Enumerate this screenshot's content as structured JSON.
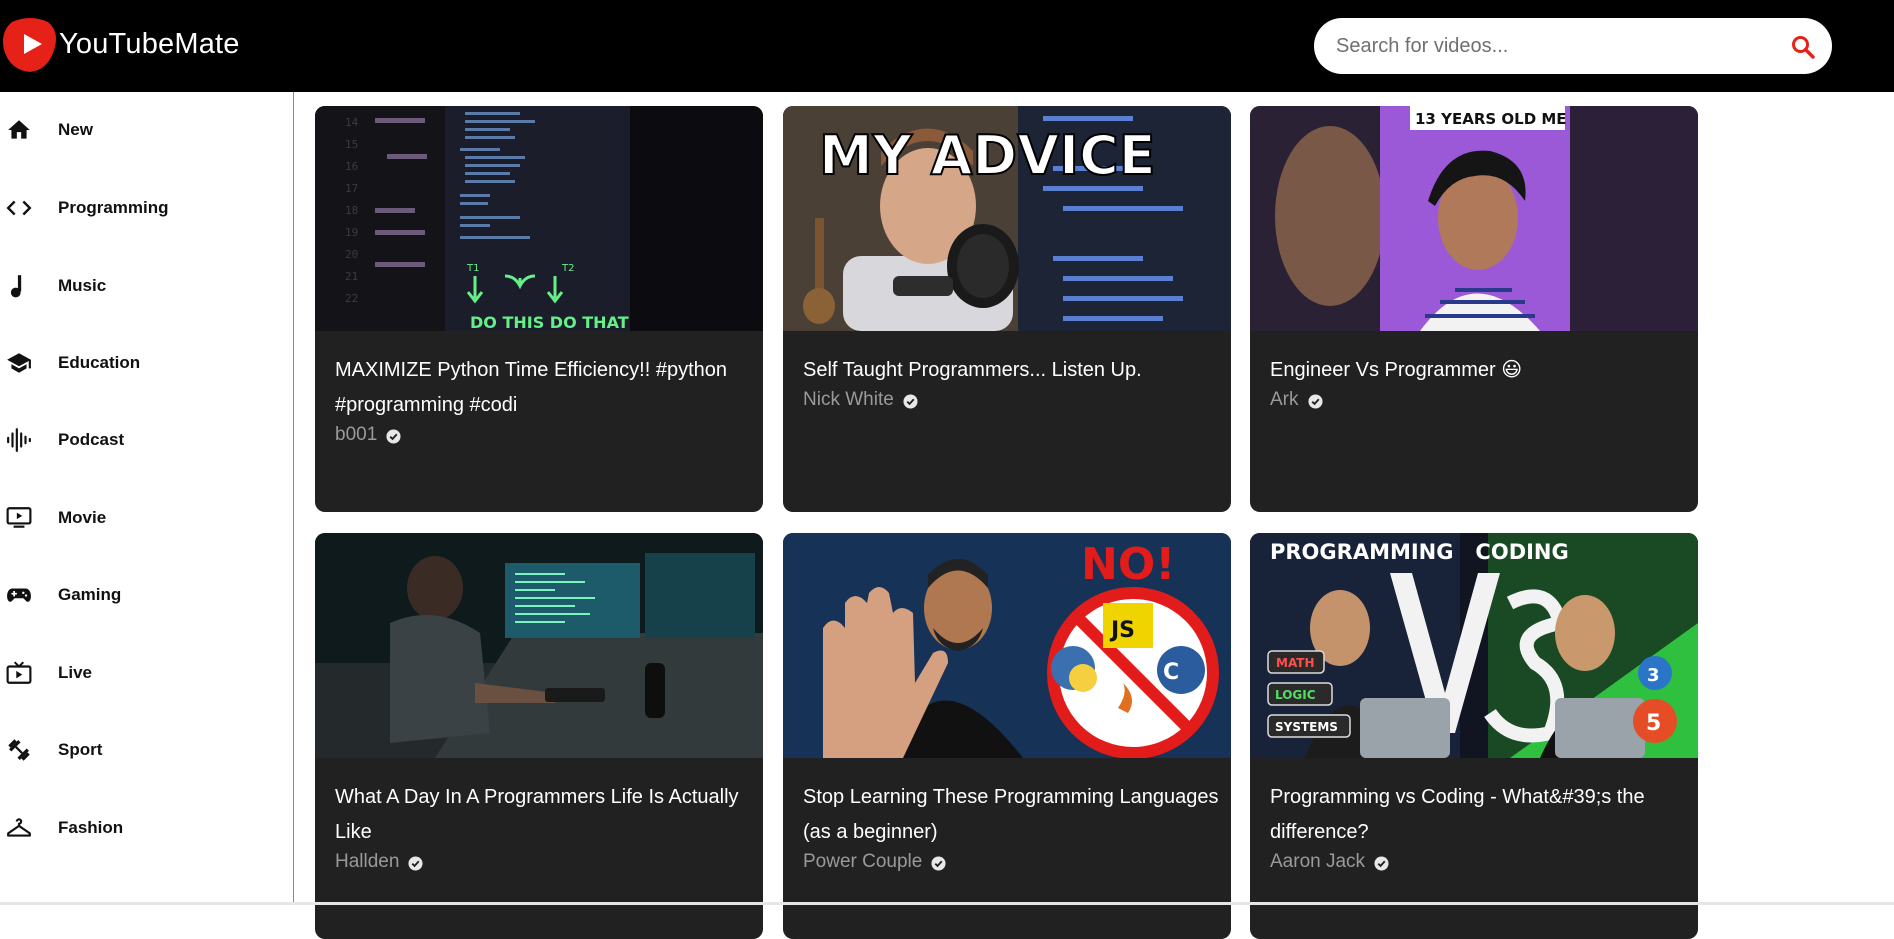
{
  "app": {
    "name": "YouTubeMate",
    "brand_color": "#e62117"
  },
  "search": {
    "placeholder": "Search for videos...",
    "icon": "search-icon"
  },
  "sidebar": {
    "items": [
      {
        "label": "New",
        "icon": "home-icon"
      },
      {
        "label": "Programming",
        "icon": "code-icon"
      },
      {
        "label": "Music",
        "icon": "music-note-icon"
      },
      {
        "label": "Education",
        "icon": "graduation-cap-icon"
      },
      {
        "label": "Podcast",
        "icon": "audio-wave-icon"
      },
      {
        "label": "Movie",
        "icon": "tv-play-icon"
      },
      {
        "label": "Gaming",
        "icon": "gamepad-icon"
      },
      {
        "label": "Live",
        "icon": "live-tv-icon"
      },
      {
        "label": "Sport",
        "icon": "dumbbell-icon"
      },
      {
        "label": "Fashion",
        "icon": "hanger-icon"
      }
    ]
  },
  "videos": [
    {
      "title": "MAXIMIZE Python Time Efficiency!! #python #programming #codi",
      "channel": "b001",
      "thumbnail_text": "DO THIS   DO THAT"
    },
    {
      "title": "Self Taught Programmers... Listen Up.",
      "channel": "Nick White",
      "thumbnail_text": "MY ADVICE"
    },
    {
      "title": "Engineer Vs Programmer 😃",
      "channel": "Ark",
      "thumbnail_text": "13 YEARS OLD ME"
    },
    {
      "title": "What A Day In A Programmers Life Is Actually Like",
      "channel": "Hallden",
      "thumbnail_text": ""
    },
    {
      "title": "Stop Learning These Programming Languages (as a beginner)",
      "channel": "Power Couple",
      "thumbnail_text": "NO!"
    },
    {
      "title": "Programming vs Coding - What&#39;s the difference?",
      "channel": "Aaron Jack",
      "thumbnail_text": "PROGRAMMING   CODING"
    }
  ]
}
